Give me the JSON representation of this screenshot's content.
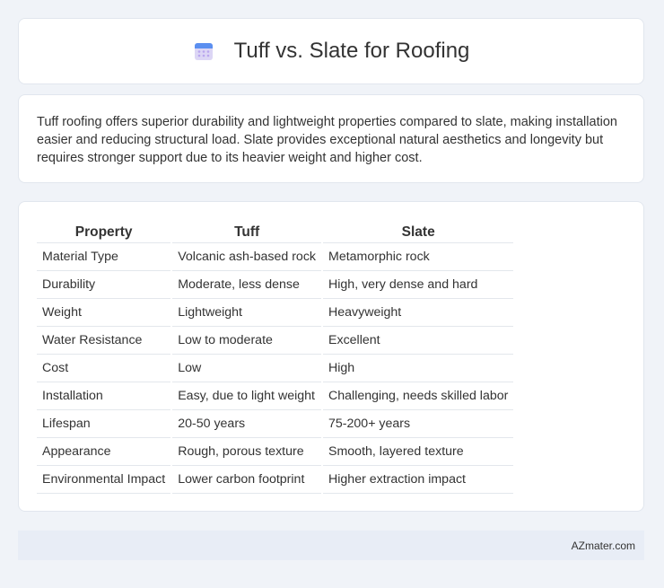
{
  "header": {
    "title": "Tuff vs. Slate for Roofing",
    "icon": "calendar-icon"
  },
  "summary": {
    "text": "Tuff roofing offers superior durability and lightweight properties compared to slate, making installation easier and reducing structural load. Slate provides exceptional natural aesthetics and longevity but requires stronger support due to its heavier weight and higher cost."
  },
  "table": {
    "headers": [
      "Property",
      "Tuff",
      "Slate"
    ],
    "rows": [
      [
        "Material Type",
        "Volcanic ash-based rock",
        "Metamorphic rock"
      ],
      [
        "Durability",
        "Moderate, less dense",
        "High, very dense and hard"
      ],
      [
        "Weight",
        "Lightweight",
        "Heavyweight"
      ],
      [
        "Water Resistance",
        "Low to moderate",
        "Excellent"
      ],
      [
        "Cost",
        "Low",
        "High"
      ],
      [
        "Installation",
        "Easy, due to light weight",
        "Challenging, needs skilled labor"
      ],
      [
        "Lifespan",
        "20-50 years",
        "75-200+ years"
      ],
      [
        "Appearance",
        "Rough, porous texture",
        "Smooth, layered texture"
      ],
      [
        "Environmental Impact",
        "Lower carbon footprint",
        "Higher extraction impact"
      ]
    ]
  },
  "footer": {
    "text": "AZmater.com"
  }
}
